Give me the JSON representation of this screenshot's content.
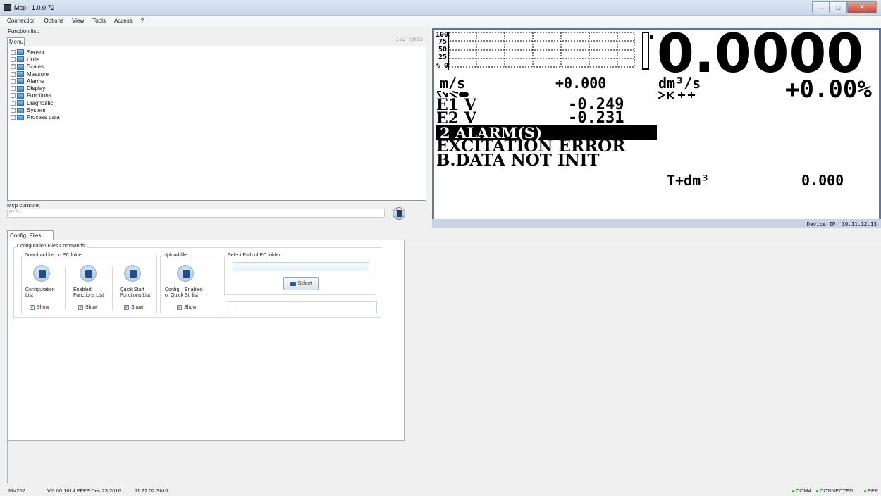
{
  "window": {
    "title": "Mcp - 1.0.0.72"
  },
  "menu": [
    "Connection",
    "Options",
    "View",
    "Tools",
    "Access",
    "?"
  ],
  "function_list": {
    "label": "Function list:",
    "tab": "Menu",
    "cmds": "162 cmds",
    "items": [
      "Sensor",
      "Units",
      "Scales",
      "Measure",
      "Alarms",
      "Display",
      "Functions",
      "Diagnostic",
      "System",
      "Process data"
    ]
  },
  "console": {
    "label": "Mcp console:",
    "prompt": "MCP>"
  },
  "display": {
    "bar_ticks": [
      "100",
      "75",
      "50",
      "25",
      "% 0"
    ],
    "big_value": "0.0000",
    "velocity_unit": "m/s",
    "velocity_value": "+0.000",
    "flow_unit": "dm³/s",
    "percent_value": "+0.00%",
    "e1_label": "E1 V",
    "e1_value": "-0.249",
    "e2_label": "E2 V",
    "e2_value": "-0.231",
    "alarm_count": "2 ALARM(S)",
    "alarm_1": "EXCITATION ERROR",
    "alarm_2": "B.DATA NOT INIT",
    "totalizer_label": "T+dm³",
    "totalizer_value": "0.000",
    "device_ip": "Device IP: 10.11.12.13"
  },
  "config": {
    "tab": "Config. Files",
    "group_title": "Configuration Files Commands:",
    "download_title": "Download file on PC folder:",
    "upload_title": "Upload file:",
    "path_title": "Select Path of PC folder:",
    "buttons": [
      {
        "line1": "Configuration",
        "line2": "List",
        "show": "Show"
      },
      {
        "line1": "Enabled",
        "line2": "Functions List",
        "show": "Show"
      },
      {
        "line1": "Quick Start",
        "line2": "Functions List",
        "show": "Show"
      },
      {
        "line1": "Config. , Enabled",
        "line2": "or Quick St. list",
        "show": "Show"
      }
    ],
    "select_label": "Select"
  },
  "status": {
    "model": "MV252",
    "version": "V.0.00.1614.FFFF Dec 23 2016",
    "time": "11:22:02 SN:0",
    "port": "COM4",
    "connection": "CONNECTED",
    "protocol": "PPP",
    "ok_color": "#1fb82a"
  }
}
